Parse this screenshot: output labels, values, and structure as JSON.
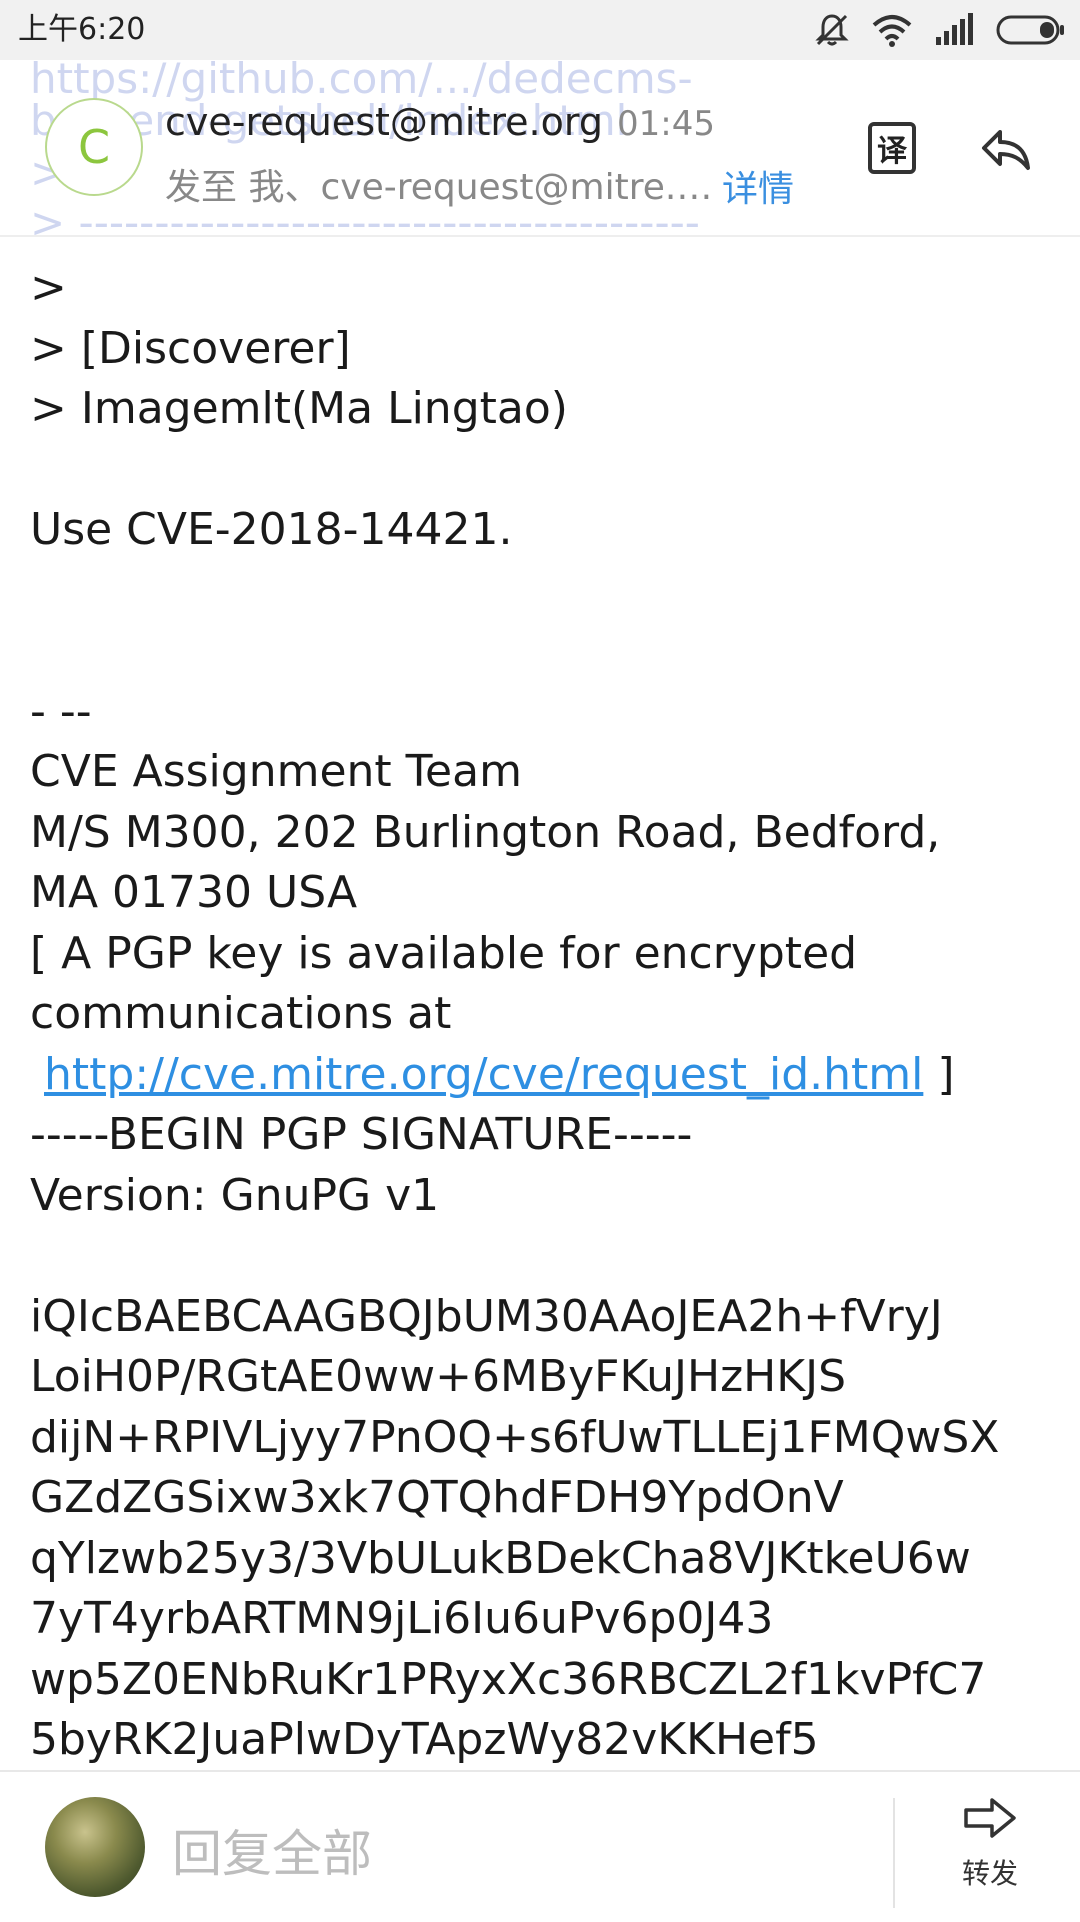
{
  "status_bar": {
    "time": "上午6:20",
    "icons": [
      "mute-icon",
      "wifi-icon",
      "signal-icon",
      "battery-icon"
    ]
  },
  "email_header": {
    "sender_initial": "C",
    "sender": "cve-request@mitre.org",
    "sent_time": "01:45",
    "recipients_prefix": "发至",
    "recipients": "我、cve-request@mitre.o…",
    "details_label": "详情",
    "translate_label": "译",
    "ghost_lines": [
      "https://github.com/.../dedecms-",
      "backend-getshell/index.html",
      ">",
      "> -----------------------------------------"
    ]
  },
  "body_lines": [
    ">",
    "> [Discoverer]",
    "> Imagemlt(Ma Lingtao)",
    "",
    "Use CVE-2018-14421.",
    "",
    "",
    "- --",
    "CVE Assignment Team",
    "M/S M300, 202 Burlington Road, Bedford,",
    "MA 01730 USA",
    "[ A PGP key is available for encrypted",
    "communications at",
    "LINK",
    "-----BEGIN PGP SIGNATURE-----",
    "Version: GnuPG v1",
    "",
    "iQIcBAEBCAAGBQJbUM30AAoJEA2h+fVryJ",
    "LoiH0P/RGtAE0ww+6MByFKuJHzHKJS",
    "dijN+RPIVLjyy7PnOQ+s6fUwTLLEj1FMQwSX",
    "GZdZGSixw3xk7QTQhdFDH9YpdOnV",
    "qYlzwb25y3/3VbULukBDekCha8VJKtkeU6w",
    "7yT4yrbARTMN9jLi6Iu6uPv6p0J43",
    "wp5Z0ENbRuKr1PRyxXc36RBCZL2f1kvPfC7",
    "5byRK2JuaPlwDyTApzWy82vKKHef5"
  ],
  "link": {
    "url_text": "http://cve.mitre.org/cve/request_id.html",
    "suffix": " ]"
  },
  "bottom_bar": {
    "reply_all_label": "回复全部",
    "forward_label": "转发"
  }
}
